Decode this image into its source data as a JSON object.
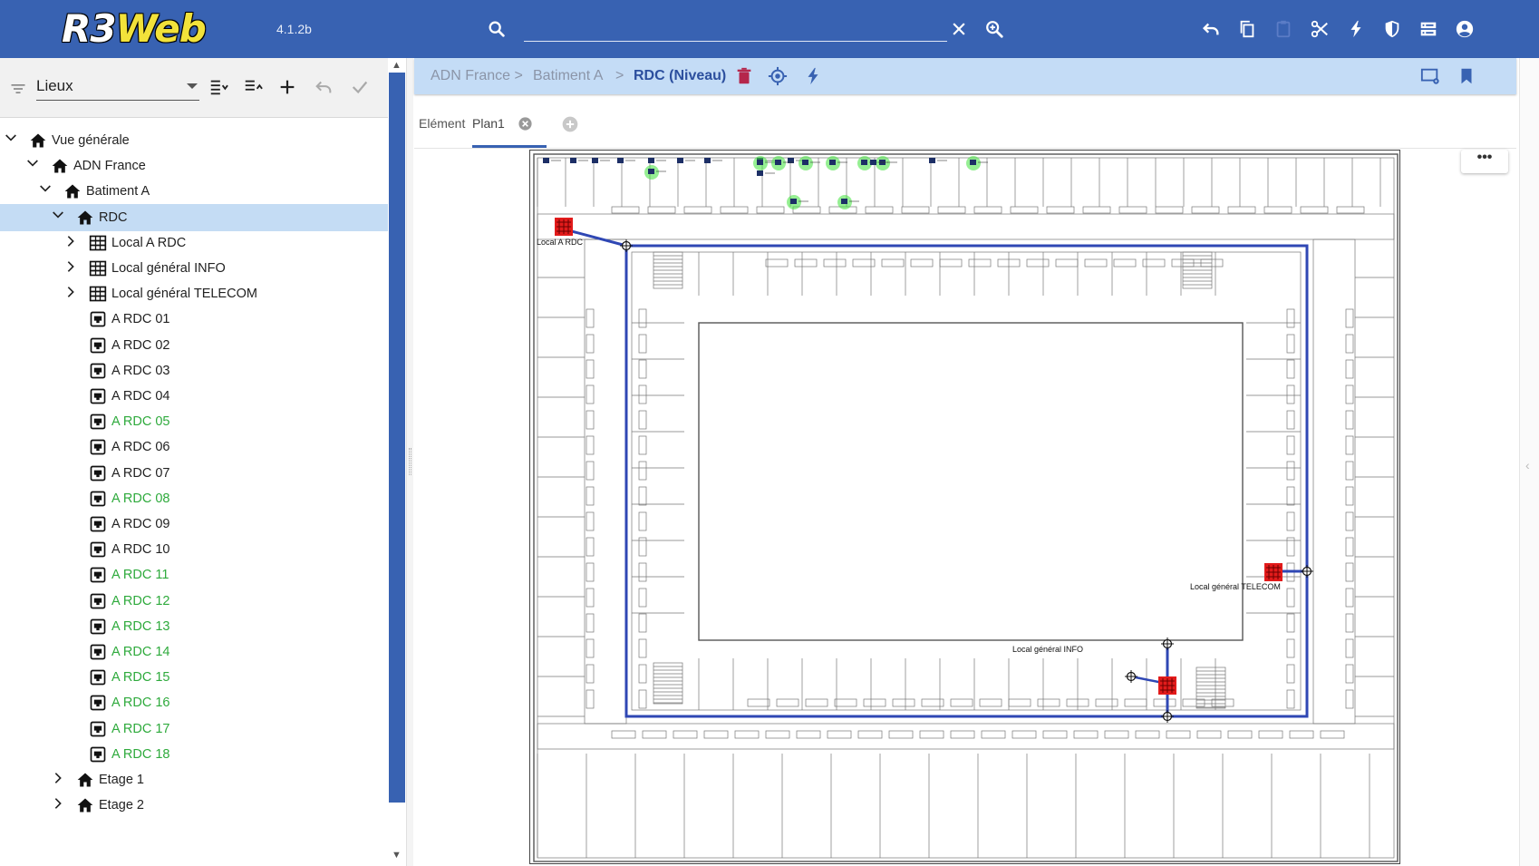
{
  "app": {
    "logo_main": "R3",
    "logo_web": "Web",
    "version": "4.1.2b"
  },
  "topbar": {
    "search_placeholder": "",
    "icons": [
      "search-icon",
      "clear-icon",
      "zoom-in-icon",
      "undo-icon",
      "copy-icon",
      "paste-icon",
      "cut-icon",
      "flash-icon",
      "shield-icon",
      "storage-icon",
      "account-icon"
    ]
  },
  "left": {
    "selector_label": "Lieux",
    "tree": [
      {
        "label": "Vue générale",
        "icon": "home",
        "level": 0,
        "chevron": "down"
      },
      {
        "label": "ADN France",
        "icon": "home",
        "level": 1,
        "chevron": "down"
      },
      {
        "label": "Batiment A",
        "icon": "home",
        "level": 2,
        "chevron": "down"
      },
      {
        "label": "RDC",
        "icon": "home",
        "level": 3,
        "chevron": "down",
        "selected": true
      },
      {
        "label": "Local A RDC",
        "icon": "rack",
        "level": 4,
        "chevron": "right"
      },
      {
        "label": "Local général INFO",
        "icon": "rack",
        "level": 4,
        "chevron": "right"
      },
      {
        "label": "Local général TELECOM",
        "icon": "rack",
        "level": 4,
        "chevron": "right"
      },
      {
        "label": "A RDC 01",
        "icon": "outlet",
        "level": 4
      },
      {
        "label": "A RDC 02",
        "icon": "outlet",
        "level": 4
      },
      {
        "label": "A RDC 03",
        "icon": "outlet",
        "level": 4
      },
      {
        "label": "A RDC 04",
        "icon": "outlet",
        "level": 4
      },
      {
        "label": "A RDC 05",
        "icon": "outlet",
        "level": 4,
        "green": true
      },
      {
        "label": "A RDC 06",
        "icon": "outlet",
        "level": 4
      },
      {
        "label": "A RDC 07",
        "icon": "outlet",
        "level": 4
      },
      {
        "label": "A RDC 08",
        "icon": "outlet",
        "level": 4,
        "green": true
      },
      {
        "label": "A RDC 09",
        "icon": "outlet",
        "level": 4
      },
      {
        "label": "A RDC 10",
        "icon": "outlet",
        "level": 4
      },
      {
        "label": "A RDC 11",
        "icon": "outlet",
        "level": 4,
        "green": true
      },
      {
        "label": "A RDC 12",
        "icon": "outlet",
        "level": 4,
        "green": true
      },
      {
        "label": "A RDC 13",
        "icon": "outlet",
        "level": 4,
        "green": true
      },
      {
        "label": "A RDC 14",
        "icon": "outlet",
        "level": 4,
        "green": true
      },
      {
        "label": "A RDC 15",
        "icon": "outlet",
        "level": 4,
        "green": true
      },
      {
        "label": "A RDC 16",
        "icon": "outlet",
        "level": 4,
        "green": true
      },
      {
        "label": "A RDC 17",
        "icon": "outlet",
        "level": 4,
        "green": true
      },
      {
        "label": "A RDC 18",
        "icon": "outlet",
        "level": 4,
        "green": true
      },
      {
        "label": "Etage 1",
        "icon": "home",
        "level": 3,
        "chevron": "right"
      },
      {
        "label": "Etage 2",
        "icon": "home",
        "level": 3,
        "chevron": "right"
      }
    ]
  },
  "breadcrumb": {
    "items": [
      "ADN France >",
      "Batiment A",
      ">",
      "RDC (Niveau)"
    ]
  },
  "tabs": {
    "element_label": "Elément",
    "plan_label": "Plan1"
  },
  "plan": {
    "more_label": "•••",
    "labels": {
      "local_a": "Local A RDC",
      "local_info": "Local général INFO",
      "local_telecom": "Local général TELECOM"
    },
    "colors": {
      "cable": "#2f47b4",
      "rack": "#e21b1b",
      "active_outlet": "#3fe23a"
    }
  },
  "colors": {
    "topbar": "#3862b2",
    "breadcrumb_bg": "#c4dcf6",
    "selected_row": "#c4dcf4",
    "green_text": "#2eaa3c"
  }
}
